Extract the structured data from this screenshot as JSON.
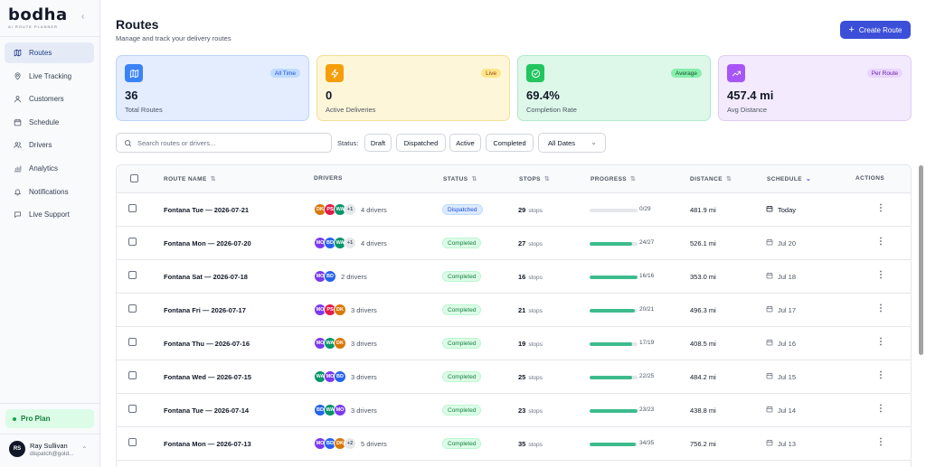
{
  "sidebar": {
    "logo_word": "bodha",
    "logo_sub": "AI ROUTE PLANNER",
    "items": [
      {
        "label": "Routes",
        "icon": "map-icon",
        "active": true
      },
      {
        "label": "Live Tracking",
        "icon": "map-pin-icon"
      },
      {
        "label": "Customers",
        "icon": "user-icon"
      },
      {
        "label": "Schedule",
        "icon": "calendar-icon"
      },
      {
        "label": "Drivers",
        "icon": "users-icon"
      },
      {
        "label": "Analytics",
        "icon": "bar-chart-icon"
      },
      {
        "label": "Notifications",
        "icon": "bell-icon"
      },
      {
        "label": "Live Support",
        "icon": "chat-icon"
      }
    ],
    "plan": "Pro Plan",
    "user": {
      "initials": "RS",
      "name": "Ray Sullivan",
      "email": "dispatch@gold..."
    }
  },
  "header": {
    "title": "Routes",
    "subtitle": "Manage and track your delivery routes",
    "create_label": "Create Route"
  },
  "stats": [
    {
      "value": "36",
      "label": "Total Routes",
      "badge": "All Time",
      "icon": "map-icon",
      "bg": "#e3edfd",
      "border": "#bfd3f6",
      "icon_bg": "#3b82f6",
      "badge_bg": "#bfdbfe",
      "badge_color": "#1d4ed8"
    },
    {
      "value": "0",
      "label": "Active Deliveries",
      "badge": "Live",
      "icon": "bolt-icon",
      "bg": "#fef6d8",
      "border": "#f5df98",
      "icon_bg": "#f59e0b",
      "badge_bg": "#fde68a",
      "badge_color": "#92400e"
    },
    {
      "value": "69.4%",
      "label": "Completion Rate",
      "badge": "Average",
      "icon": "check-circle-icon",
      "bg": "#ddf7e9",
      "border": "#b3e9cc",
      "icon_bg": "#22c55e",
      "badge_bg": "#86efac",
      "badge_color": "#14532d"
    },
    {
      "value": "457.4 mi",
      "label": "Avg Distance",
      "badge": "Per Route",
      "icon": "trend-up-icon",
      "bg": "#f3eafd",
      "border": "#e0ccf8",
      "icon_bg": "#a855f7",
      "badge_bg": "#e9d5ff",
      "badge_color": "#6b21a8"
    }
  ],
  "filters": {
    "search_placeholder": "Search routes or drivers...",
    "status_label": "Status:",
    "chips": [
      "Draft",
      "Dispatched",
      "Active",
      "Completed"
    ],
    "date": "All Dates"
  },
  "table": {
    "columns": {
      "route_name": "ROUTE NAME",
      "drivers": "DRIVERS",
      "status": "STATUS",
      "stops": "STOPS",
      "progress": "PROGRESS",
      "distance": "DISTANCE",
      "schedule": "SCHEDULE",
      "actions": "ACTIONS"
    },
    "stops_unit": "stops",
    "rows": [
      {
        "name": "Fontana Tue — 2026-07-21",
        "avatars": [
          {
            "i": "DK",
            "c": "#d97706"
          },
          {
            "i": "PS",
            "c": "#e11d48"
          },
          {
            "i": "WA",
            "c": "#059669"
          }
        ],
        "more": "+1",
        "drivers": "4 drivers",
        "status": "Dispatched",
        "stops": "29",
        "done": 0,
        "total": 29,
        "progress": "0/29",
        "distance": "481.9 mi",
        "schedule": "Today",
        "today": true
      },
      {
        "name": "Fontana Mon — 2026-07-20",
        "avatars": [
          {
            "i": "MO",
            "c": "#7c3aed"
          },
          {
            "i": "BD",
            "c": "#2563eb"
          },
          {
            "i": "WA",
            "c": "#059669"
          }
        ],
        "more": "+1",
        "drivers": "4 drivers",
        "status": "Completed",
        "stops": "27",
        "done": 24,
        "total": 27,
        "progress": "24/27",
        "distance": "526.1 mi",
        "schedule": "Jul 20"
      },
      {
        "name": "Fontana Sat — 2026-07-18",
        "avatars": [
          {
            "i": "MO",
            "c": "#7c3aed"
          },
          {
            "i": "BD",
            "c": "#2563eb"
          }
        ],
        "more": "",
        "drivers": "2 drivers",
        "status": "Completed",
        "stops": "16",
        "done": 16,
        "total": 16,
        "progress": "16/16",
        "distance": "353.0 mi",
        "schedule": "Jul 18"
      },
      {
        "name": "Fontana Fri — 2026-07-17",
        "avatars": [
          {
            "i": "MO",
            "c": "#7c3aed"
          },
          {
            "i": "PS",
            "c": "#e11d48"
          },
          {
            "i": "DK",
            "c": "#d97706"
          }
        ],
        "more": "",
        "drivers": "3 drivers",
        "status": "Completed",
        "stops": "21",
        "done": 20,
        "total": 21,
        "progress": "20/21",
        "distance": "496.3 mi",
        "schedule": "Jul 17"
      },
      {
        "name": "Fontana Thu — 2026-07-16",
        "avatars": [
          {
            "i": "MO",
            "c": "#7c3aed"
          },
          {
            "i": "WA",
            "c": "#059669"
          },
          {
            "i": "DK",
            "c": "#d97706"
          }
        ],
        "more": "",
        "drivers": "3 drivers",
        "status": "Completed",
        "stops": "19",
        "done": 17,
        "total": 19,
        "progress": "17/19",
        "distance": "408.5 mi",
        "schedule": "Jul 16"
      },
      {
        "name": "Fontana Wed — 2026-07-15",
        "avatars": [
          {
            "i": "WA",
            "c": "#059669"
          },
          {
            "i": "MO",
            "c": "#7c3aed"
          },
          {
            "i": "BD",
            "c": "#2563eb"
          }
        ],
        "more": "",
        "drivers": "3 drivers",
        "status": "Completed",
        "stops": "25",
        "done": 22,
        "total": 25,
        "progress": "22/25",
        "distance": "484.2 mi",
        "schedule": "Jul 15"
      },
      {
        "name": "Fontana Tue — 2026-07-14",
        "avatars": [
          {
            "i": "BD",
            "c": "#2563eb"
          },
          {
            "i": "WA",
            "c": "#059669"
          },
          {
            "i": "MO",
            "c": "#7c3aed"
          }
        ],
        "more": "",
        "drivers": "3 drivers",
        "status": "Completed",
        "stops": "23",
        "done": 23,
        "total": 23,
        "progress": "23/23",
        "distance": "438.8 mi",
        "schedule": "Jul 14"
      },
      {
        "name": "Fontana Mon — 2026-07-13",
        "avatars": [
          {
            "i": "MO",
            "c": "#7c3aed"
          },
          {
            "i": "BD",
            "c": "#2563eb"
          },
          {
            "i": "DK",
            "c": "#d97706"
          }
        ],
        "more": "+2",
        "drivers": "5 drivers",
        "status": "Completed",
        "stops": "35",
        "done": 34,
        "total": 35,
        "progress": "34/35",
        "distance": "756.2 mi",
        "schedule": "Jul 13"
      }
    ]
  }
}
